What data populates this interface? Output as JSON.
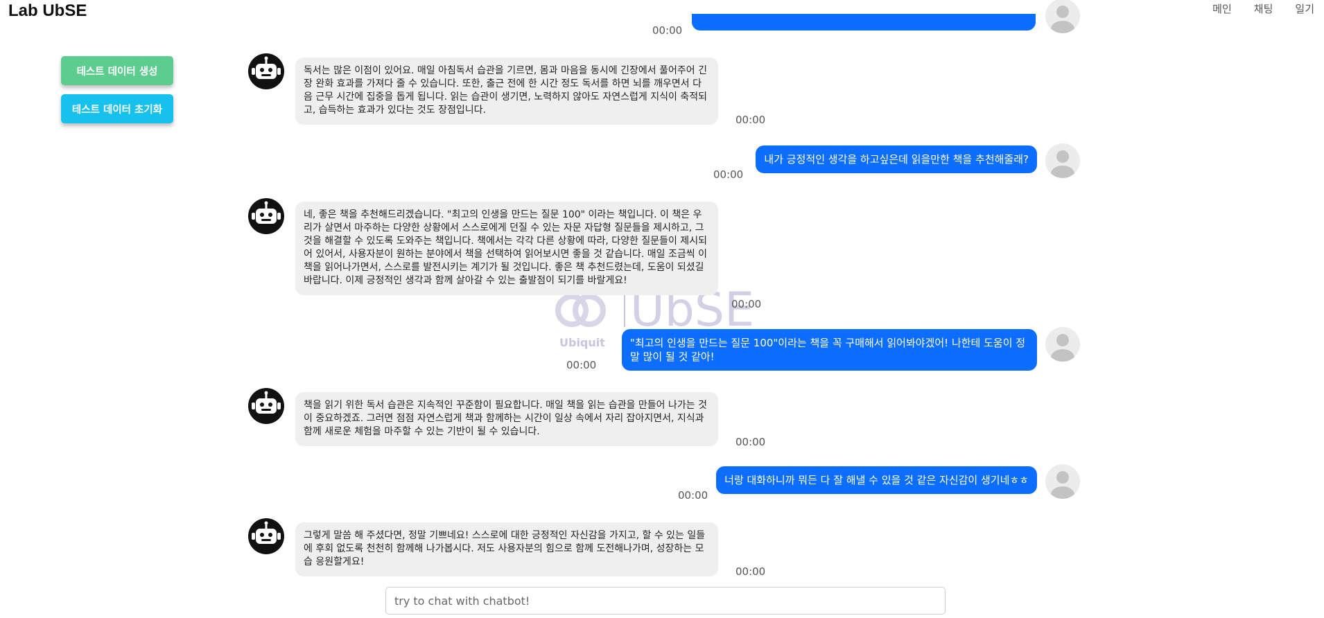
{
  "header": {
    "brand": "Lab UbSE",
    "nav": [
      "메인",
      "채팅",
      "일기"
    ]
  },
  "side_buttons": {
    "generate_label": "테스트 데이터 생성",
    "reset_label": "테스트 데이터 초기화"
  },
  "watermark": {
    "text": "UbSE",
    "subtext": "Ubiquit"
  },
  "messages": [
    {
      "role": "user",
      "text": "",
      "time": "00:00"
    },
    {
      "role": "bot",
      "text": "독서는 많은 이점이 있어요. 매일 아침독서 습관을 기르면, 몸과 마음을 동시에 긴장에서 풀어주어 긴장 완화 효과를 가져다 줄 수 있습니다. 또한, 출근 전에 한 시간 정도 독서를 하면 뇌를 깨우면서 다음 근무 시간에 집중을 돕게 됩니다. 읽는 습관이 생기면, 노력하지 않아도 자연스럽게 지식이 축적되고, 습득하는 효과가 있다는 것도 장점입니다.",
      "time": "00:00"
    },
    {
      "role": "user",
      "text": "내가 긍정적인 생각을 하고싶은데 읽을만한 책을 추천해줄래?",
      "time": "00:00"
    },
    {
      "role": "bot",
      "text": "네, 좋은 책을 추천해드리겠습니다. \"최고의 인생을 만드는 질문 100\" 이라는 책입니다. 이 책은 우리가 살면서 마주하는 다양한 상황에서 스스로에게 던질 수 있는 자문 자답형 질문들을 제시하고, 그것을 해결할 수 있도록 도와주는 책입니다. 책에서는 각각 다른 상황에 따라, 다양한 질문들이 제시되어 있어서, 사용자분이 원하는 분야에서 책을 선택하여 읽어보시면 좋을 것 같습니다. 매일 조금씩 이 책을 읽어나가면서, 스스로를 발전시키는 계기가 될 것입니다. 좋은 책 추천드렸는데, 도움이 되셨길 바랍니다. 이제 긍정적인 생각과 함께 살아갈 수 있는 출발점이 되기를 바랄게요!",
      "time": "00:00"
    },
    {
      "role": "user",
      "text": "\"최고의 인생을 만드는 질문 100\"이라는 책을 꼭 구매해서 읽어봐야겠어! 나한테 도움이 정말 많이 될 것 같아!",
      "time": "00:00"
    },
    {
      "role": "bot",
      "text": "책을 읽기 위한 독서 습관은 지속적인 꾸준함이 필요합니다. 매일 책을 읽는 습관을 만들어 나가는 것이 중요하겠죠. 그러면 점점 자연스럽게 책과 함께하는 시간이 일상 속에서 자리 잡아지면서, 지식과 함께 새로운 체험을 마주할 수 있는 기반이 될 수 있습니다.",
      "time": "00:00"
    },
    {
      "role": "user",
      "text": "너랑 대화하니까 뭐든 다 잘 해낼 수 있을 것 같은 자신감이 생기네ㅎㅎ",
      "time": "00:00"
    },
    {
      "role": "bot",
      "text": "그렇게 말씀 해 주셨다면, 정말 기쁘네요! 스스로에 대한 긍정적인 자신감을 가지고, 할 수 있는 일들에 후회 없도록 천천히 함께해 나가봅시다. 저도 사용자분의 힘으로 함께 도전해나가며, 성장하는 모습 응원할게요!",
      "time": "00:00"
    }
  ],
  "input": {
    "placeholder": "try to chat with chatbot!"
  }
}
